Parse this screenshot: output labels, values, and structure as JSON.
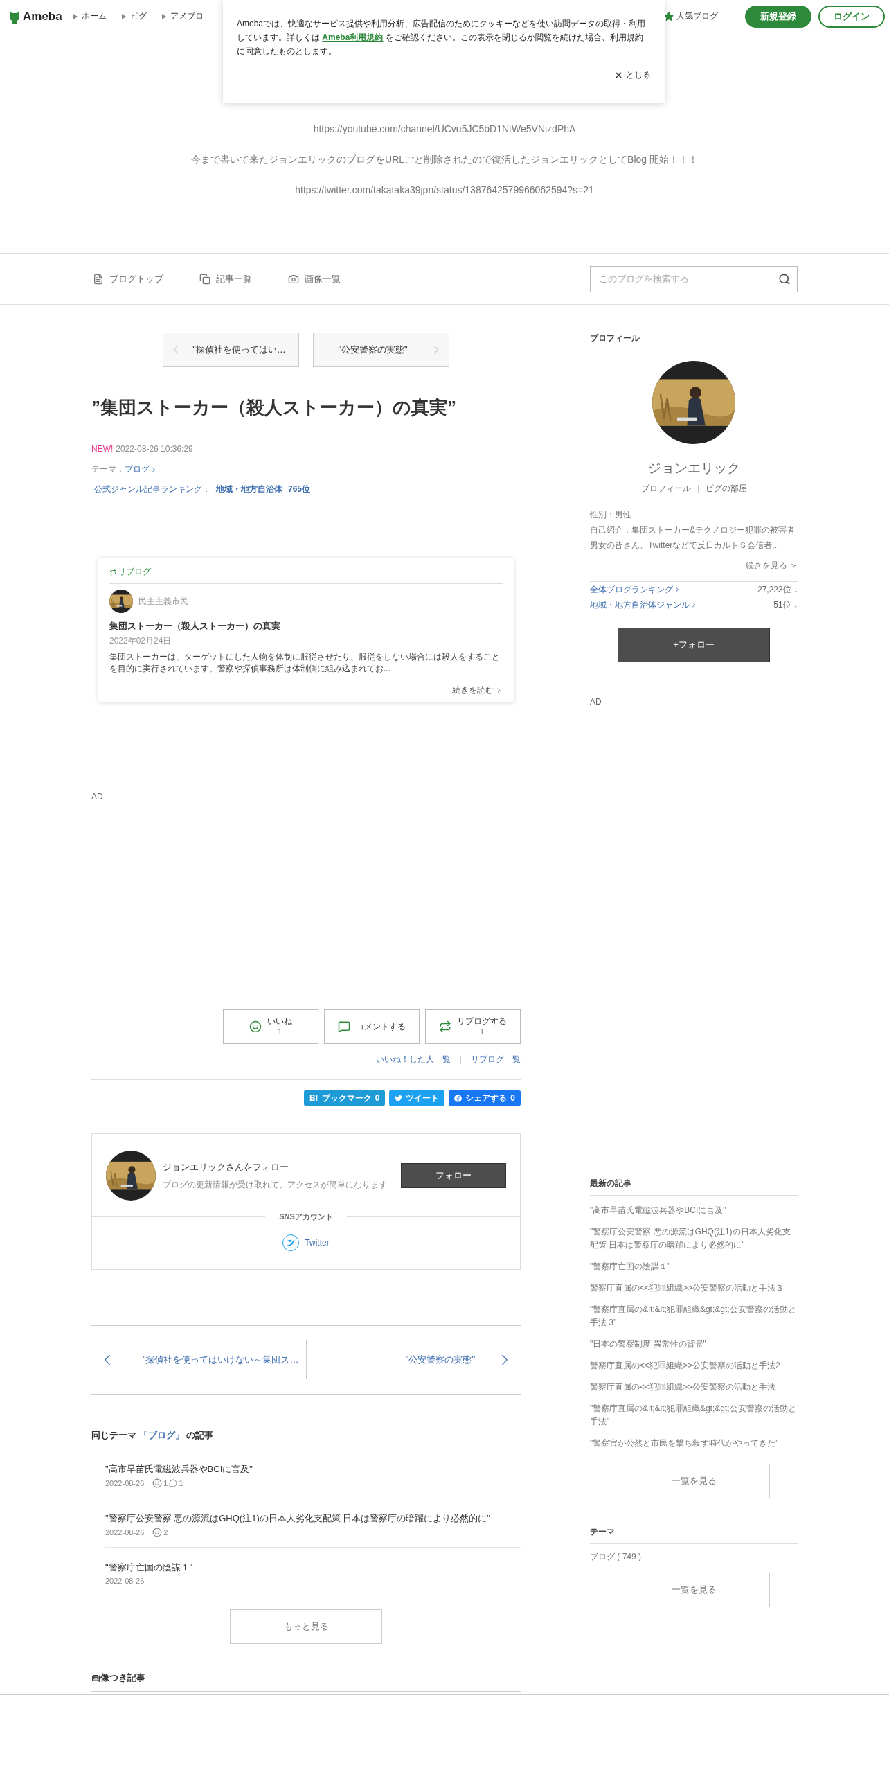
{
  "header": {
    "logo": "Ameba",
    "nav": [
      "ホーム",
      "ピグ",
      "アメブロ"
    ],
    "popular": "人気ブログ",
    "signup": "新規登録",
    "login": "ログイン"
  },
  "cookie_notice": {
    "text_before": "Amebaでは、快適なサービス提供や利用分析、広告配信のためにクッキーなどを使い訪問データの取得・利用しています。詳しくは ",
    "link": "Ameba利用規約",
    "text_after": " をご確認ください。この表示を閉じるか閲覧を続けた場合、利用規約に同意したものとします。",
    "close": "とじる"
  },
  "blog": {
    "lines": [
      "https://youtube.com/channel/UCvu5JC5bD1NtWe5VNizdPhA",
      "今まで書いて来たジョンエリックのブログをURLごと削除されたので復活したジョンエリックとしてBlog 開始！！！",
      "https://twitter.com/takataka39jpn/status/1387642579966062594?s=21"
    ]
  },
  "blog_nav": {
    "items": [
      "ブログトップ",
      "記事一覧",
      "画像一覧"
    ],
    "search": {
      "placeholder": "このブログを検索する"
    }
  },
  "article": {
    "prev": "\"探偵社を使ってはい…",
    "next": "\"公安警察の実態\"",
    "title": "”集団ストーカー（殺人ストーカー）の真実”",
    "new": "NEW!",
    "date": "2022-08-26 10:36:29",
    "theme_label": "テーマ：",
    "theme": "ブログ",
    "ranking_label": "公式ジャンル記事ランキング：",
    "ranking_genre": "地域・地方自治体",
    "ranking_rank": "765位",
    "reblog": {
      "label": "リブログ",
      "author": "民主主義市民",
      "title": "集団ストーカー（殺人ストーカー）の真実",
      "date": "2022年02月24日",
      "excerpt": "集団ストーカーは、ターゲットにした人物を体制に服従させたり、服従をしない場合には殺人をすることを目的に実行されています。警察や探偵事務所は体制側に組み込まれてお...",
      "more": "続きを読む"
    },
    "ad": "AD",
    "actions": [
      {
        "label": "いいね",
        "count": "1"
      },
      {
        "label": "コメントする"
      },
      {
        "label": "リブログする",
        "count": "1"
      }
    ],
    "links": [
      "いいね！した人一覧",
      "リブログ一覧"
    ],
    "share": [
      {
        "logo": "B!",
        "label": "ブックマーク",
        "count": "0"
      },
      {
        "label": "ツイート"
      },
      {
        "label": "シェアする",
        "count": "0"
      }
    ]
  },
  "follow_card": {
    "title": "ジョンエリックさんをフォロー",
    "subtitle": "ブログの更新情報が受け取れて、アクセスが簡単になります",
    "button": "フォロー",
    "sns_heading": "SNSアカウント",
    "sns": "Twitter"
  },
  "pager": {
    "prev": "\"探偵社を使ってはいけない～集団ス…",
    "next": "\"公安警察の実態\""
  },
  "same_theme": {
    "prefix": "同じテーマ ",
    "theme": "「ブログ」",
    "suffix": " の記事",
    "items": [
      {
        "title": "\"高市早苗氏電磁波兵器やBCIに言及\"",
        "date": "2022-08-26",
        "likes": "1",
        "comments": "1"
      },
      {
        "title": "\"警察庁公安警察 悪の源流はGHQ(注1)の日本人劣化支配策 日本は警察庁の暗躍により必然的に\"",
        "date": "2022-08-26",
        "likes": "2"
      },
      {
        "title": "\"警察庁亡国の陰謀１\"",
        "date": "2022-08-26"
      }
    ],
    "more": "もっと見る"
  },
  "image_articles": {
    "heading": "画像つき記事"
  },
  "sidebar": {
    "profile": {
      "heading": "プロフィール",
      "name": "ジョンエリック",
      "links": [
        "プロフィール",
        "ピグの部屋"
      ],
      "gender": "性別：男性",
      "intro": "自己紹介：集団ストーカー&テクノロジー犯罪の被害者男女の皆さん、Twitterなどで反日カルトＳ会信者...",
      "more": "続きを見る ＞",
      "rankings": [
        {
          "label": "全体ブログランキング",
          "rank": "27,223位 ↓"
        },
        {
          "label": "地域・地方自治体ジャンル",
          "rank": "51位 ↓"
        }
      ],
      "follow": "+フォロー"
    },
    "ad": "AD",
    "latest": {
      "heading": "最新の記事",
      "items": [
        "\"高市早苗氏電磁波兵器やBCIに言及\"",
        "\"警察庁公安警察 悪の源流はGHQ(注1)の日本人劣化支配策 日本は警察庁の暗躍により必然的に\"",
        "\"警察庁亡国の陰謀１\"",
        "警察庁直属の<<犯罪組織>>公安警察の活動と手法３",
        "\"警察庁直属の&lt;&lt;犯罪組織&gt;&gt;公安警察の活動と手法 3\"",
        "\"日本の警察制度 異常性の背景\"",
        "警察庁直属の<<犯罪組織>>公安警察の活動と手法2",
        "警察庁直属の<<犯罪組織>>公安警察の活動と手法",
        "\"警察庁直属の&lt;&lt;犯罪組織&gt;&gt;公安警察の活動と手法\"",
        "\"警察官が公然と市民を撃ち殺す時代がやってきた\""
      ],
      "button": "一覧を見る"
    },
    "themes": {
      "heading": "テーマ",
      "items": [
        "ブログ ( 749 )"
      ],
      "button": "一覧を見る"
    }
  }
}
